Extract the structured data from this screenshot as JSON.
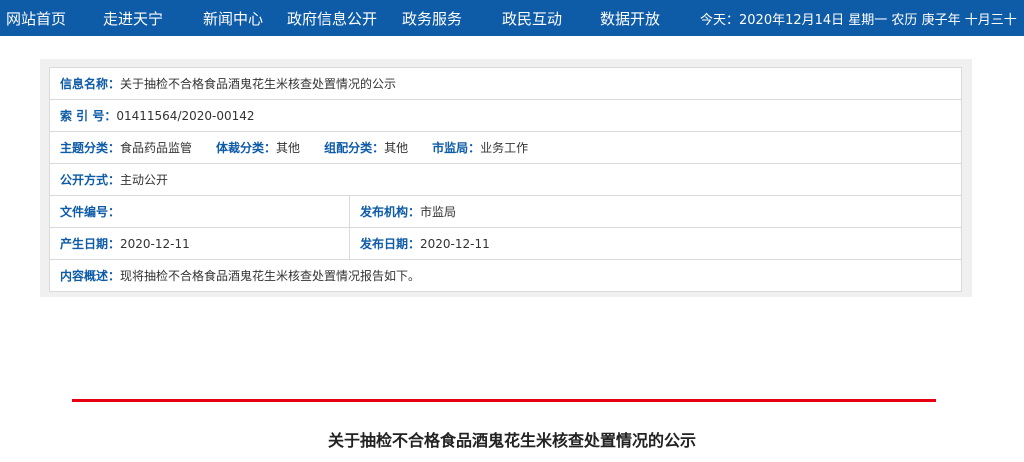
{
  "nav": {
    "items": [
      "网站首页",
      "走进天宁",
      "新闻中心",
      "政府信息公开",
      "政务服务",
      "政民互动",
      "数据开放"
    ],
    "date_text": "今天：2020年12月14日 星期一 农历 庚子年 十月三十"
  },
  "info": {
    "name_label": "信息名称：",
    "name_value": "关于抽检不合格食品酒鬼花生米核查处置情况的公示",
    "index_label": "索 引 号：",
    "index_value": "01411564/2020-00142",
    "topic_label": "主题分类：",
    "topic_value": "食品药品监管",
    "genre_label": "体裁分类：",
    "genre_value": "其他",
    "org_class_label": "组配分类：",
    "org_class_value": "其他",
    "bureau_label": "市监局：",
    "bureau_value": "业务工作",
    "open_label": "公开方式：",
    "open_value": "主动公开",
    "docno_label": "文件编号：",
    "docno_value": "",
    "publisher_label": "发布机构：",
    "publisher_value": "市监局",
    "created_label": "产生日期：",
    "created_value": "2020-12-11",
    "published_label": "发布日期：",
    "published_value": "2020-12-11",
    "summary_label": "内容概述：",
    "summary_value": "现将抽检不合格食品酒鬼花生米核查处置情况报告如下。"
  },
  "article": {
    "title": "关于抽检不合格食品酒鬼花生米核查处置情况的公示"
  },
  "colors": {
    "nav_bg": "#0e5ba8",
    "label_blue": "#0e5ba8",
    "red_rule": "#e60012"
  }
}
